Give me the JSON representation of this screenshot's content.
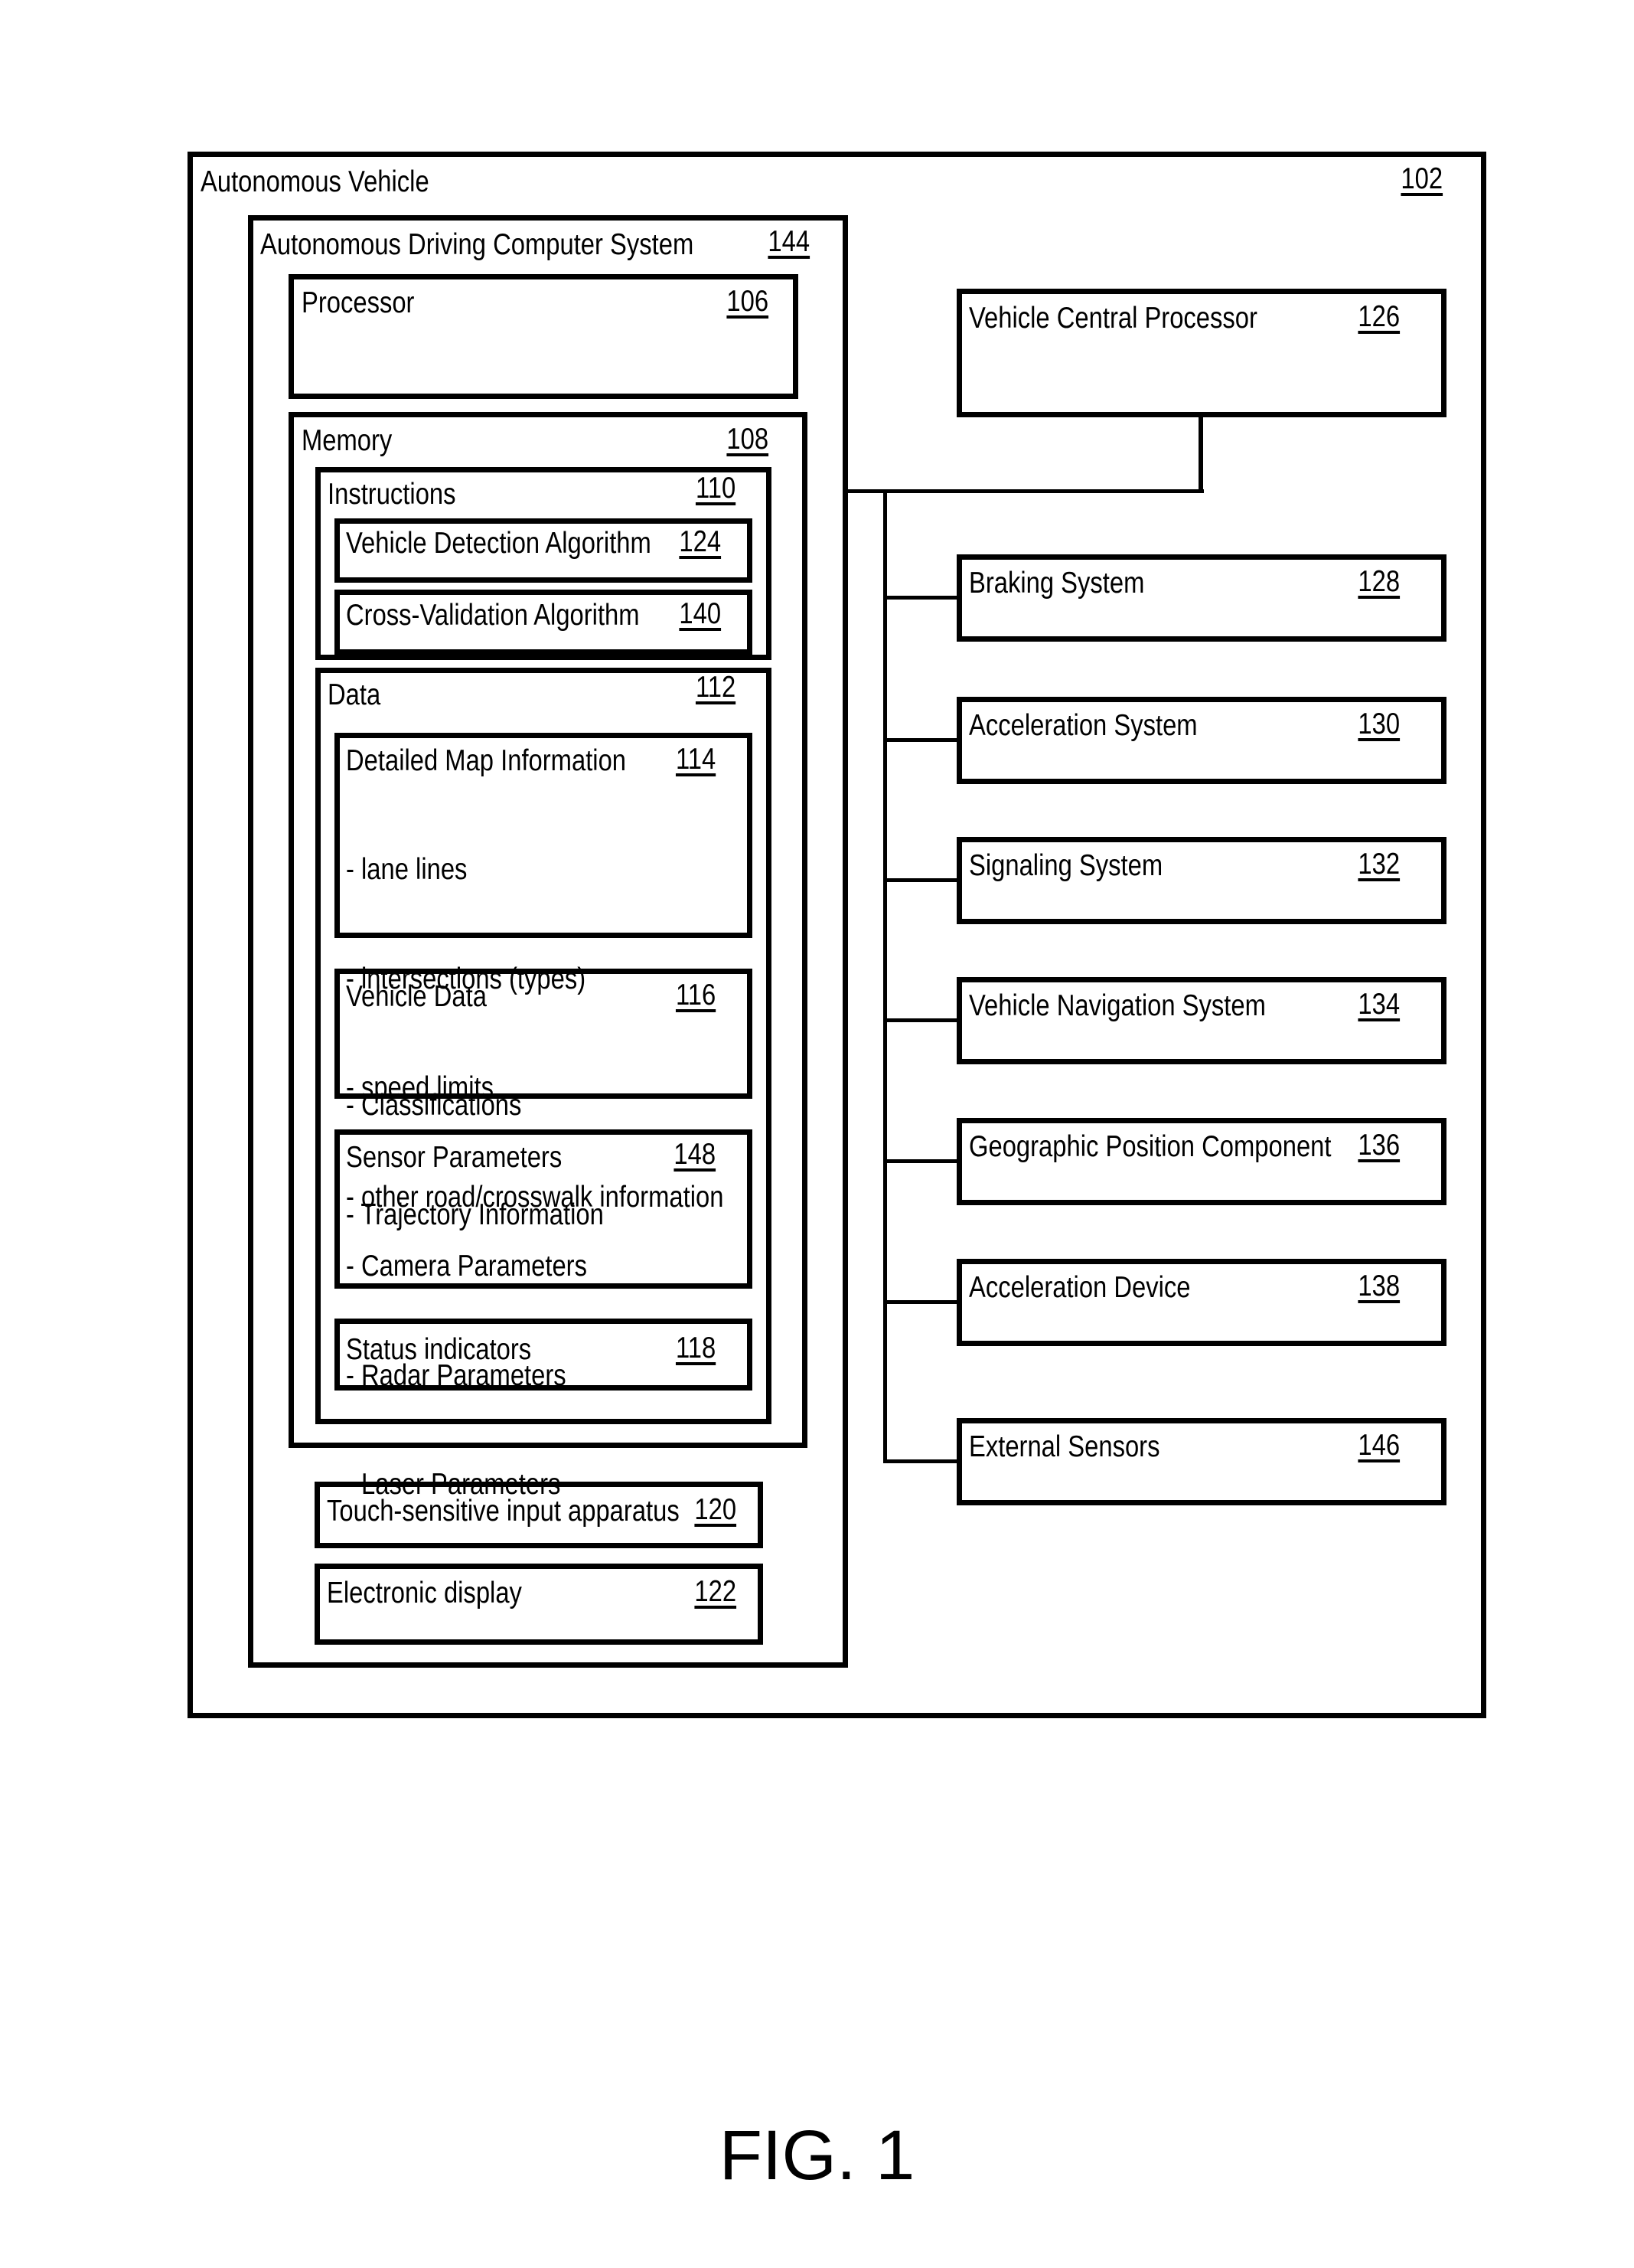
{
  "figure_label": "FIG. 1",
  "vehicle": {
    "title": "Autonomous Vehicle",
    "ref": "102"
  },
  "computer_system": {
    "title": "Autonomous Driving Computer System",
    "ref": "144"
  },
  "processor": {
    "title": "Processor",
    "ref": "106"
  },
  "memory": {
    "title": "Memory",
    "ref": "108"
  },
  "instructions": {
    "title": "Instructions",
    "ref": "110",
    "items": [
      {
        "title": "Vehicle Detection Algorithm",
        "ref": "124"
      },
      {
        "title": "Cross-Validation Algorithm",
        "ref": "140"
      }
    ]
  },
  "data": {
    "title": "Data",
    "ref": "112",
    "items": [
      {
        "title": "Detailed Map Information",
        "ref": "114",
        "lines": [
          "- lane lines",
          "- intersections (types)",
          "- speed limits",
          "- other road/crosswalk information"
        ]
      },
      {
        "title": "Vehicle Data",
        "ref": "116",
        "lines": [
          "- Classifications",
          "- Trajectory Information"
        ]
      },
      {
        "title": "Sensor Parameters",
        "ref": "148",
        "lines": [
          "- Camera Parameters",
          "- Radar Parameters",
          "- Laser Parameters"
        ]
      },
      {
        "title": "Status indicators",
        "ref": "118",
        "lines": []
      }
    ]
  },
  "touch_input": {
    "title": "Touch-sensitive input apparatus",
    "ref": "120"
  },
  "electronic_display": {
    "title": "Electronic display",
    "ref": "122"
  },
  "central_processor": {
    "title": "Vehicle Central Processor",
    "ref": "126"
  },
  "systems": [
    {
      "title": "Braking System",
      "ref": "128"
    },
    {
      "title": "Acceleration System",
      "ref": "130"
    },
    {
      "title": "Signaling System",
      "ref": "132"
    },
    {
      "title": "Vehicle Navigation System",
      "ref": "134"
    },
    {
      "title": "Geographic Position Component",
      "ref": "136"
    },
    {
      "title": "Acceleration Device",
      "ref": "138"
    },
    {
      "title": "External Sensors",
      "ref": "146"
    }
  ]
}
